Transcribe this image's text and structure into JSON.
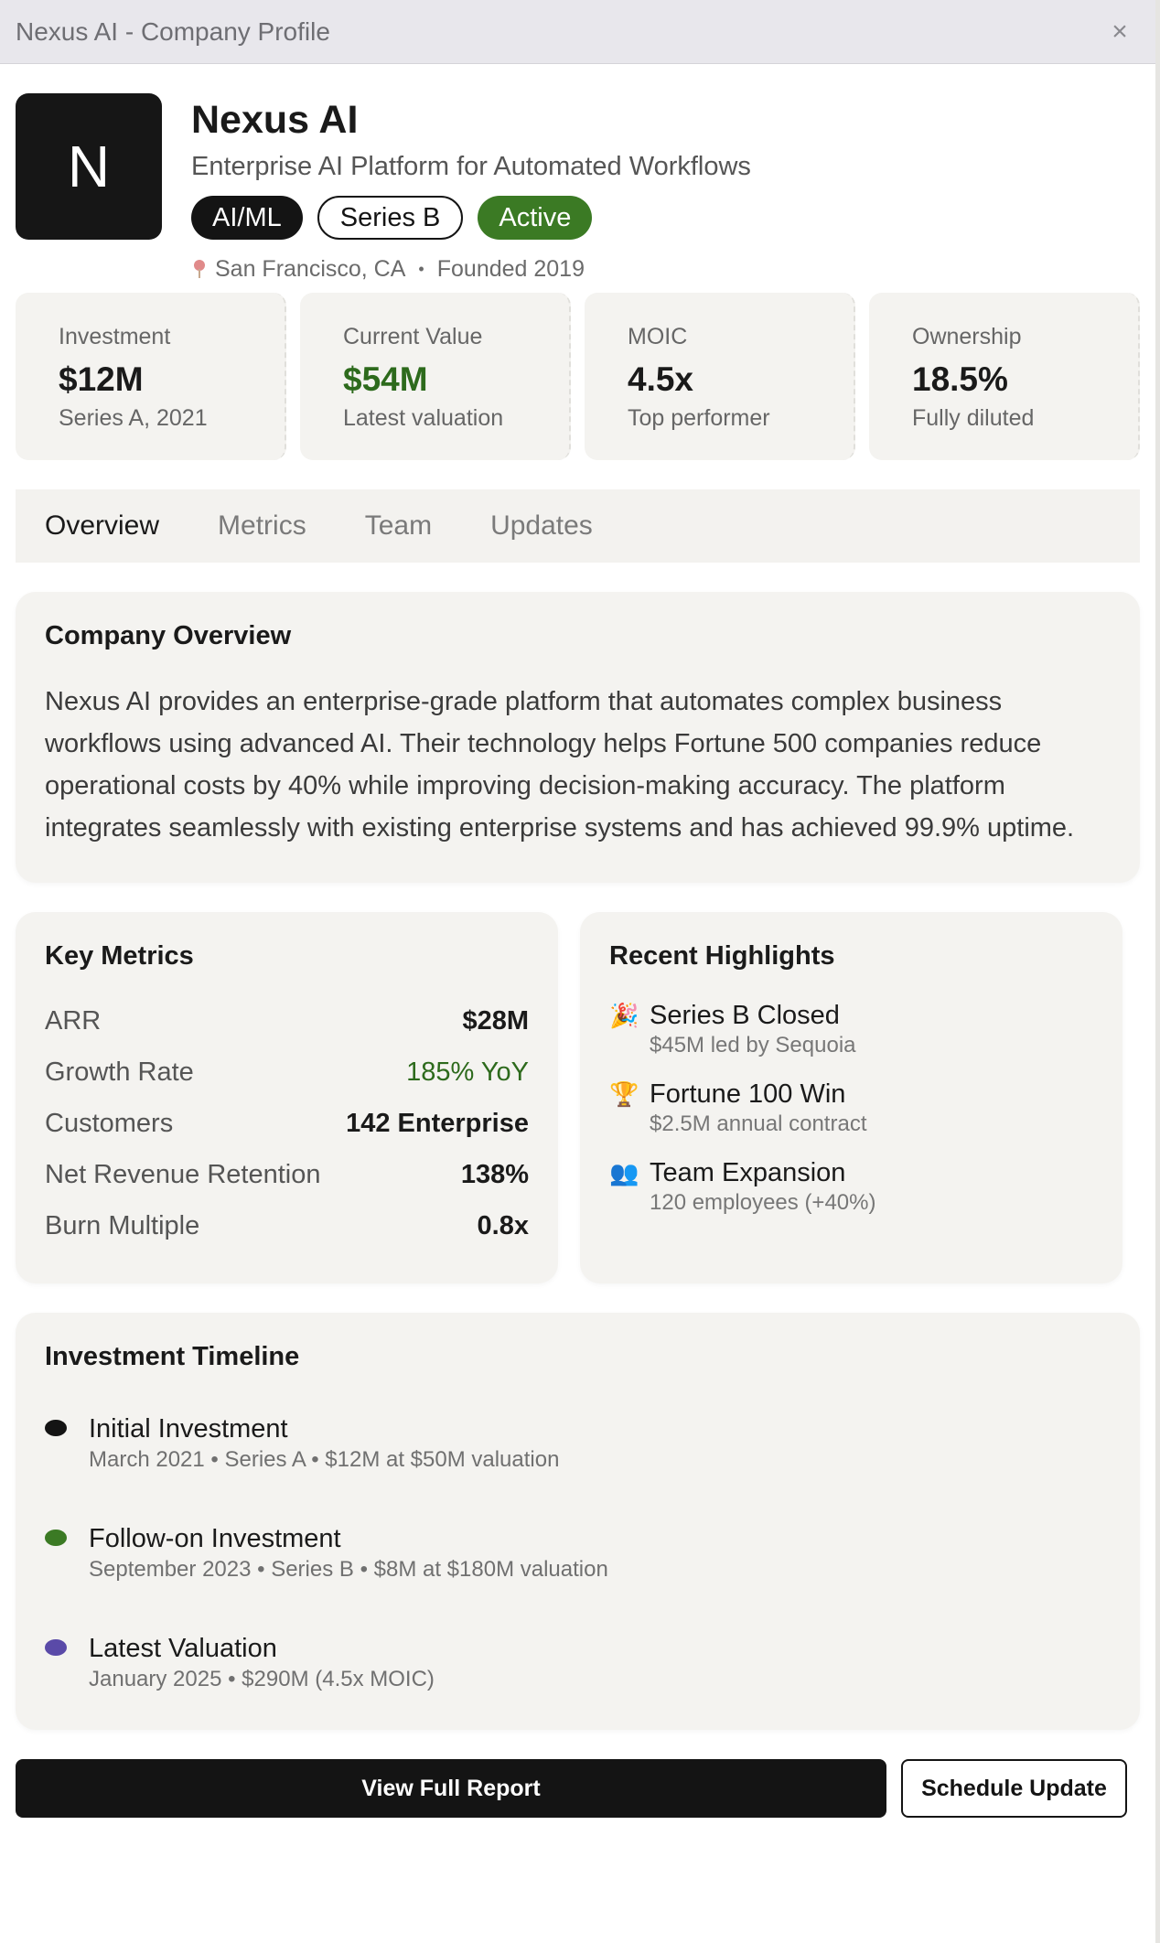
{
  "window": {
    "title": "Nexus AI - Company Profile",
    "close_symbol": "×"
  },
  "company": {
    "logo_letter": "N",
    "name": "Nexus AI",
    "tagline": "Enterprise AI Platform for Automated Workflows",
    "tags": [
      "AI/ML",
      "Series B",
      "Active"
    ],
    "location": "San Francisco, CA",
    "separator": "•",
    "founded": "Founded 2019"
  },
  "stats": [
    {
      "label": "Investment",
      "value": "$12M",
      "sub": "Series A, 2021"
    },
    {
      "label": "Current Value",
      "value": "$54M",
      "sub": "Latest valuation"
    },
    {
      "label": "MOIC",
      "value": "4.5x",
      "sub": "Top performer"
    },
    {
      "label": "Ownership",
      "value": "18.5%",
      "sub": "Fully diluted"
    }
  ],
  "tabs": [
    "Overview",
    "Metrics",
    "Team",
    "Updates"
  ],
  "overview": {
    "title": "Company Overview",
    "text": "Nexus AI provides an enterprise-grade platform that automates complex business workflows using advanced AI. Their technology helps Fortune 500 companies reduce operational costs by 40% while improving decision-making accuracy. The platform integrates seamlessly with existing enterprise systems and has achieved 99.9% uptime."
  },
  "key_metrics": {
    "title": "Key Metrics",
    "rows": [
      {
        "label": "ARR",
        "value": "$28M"
      },
      {
        "label": "Growth Rate",
        "value": "185% YoY"
      },
      {
        "label": "Customers",
        "value": "142 Enterprise"
      },
      {
        "label": "Net Revenue Retention",
        "value": "138%"
      },
      {
        "label": "Burn Multiple",
        "value": "0.8x"
      }
    ]
  },
  "highlights": {
    "title": "Recent Highlights",
    "items": [
      {
        "icon": "🎉",
        "title": "Series B Closed",
        "sub": "$45M led by Sequoia"
      },
      {
        "icon": "🏆",
        "title": "Fortune 100 Win",
        "sub": "$2.5M annual contract"
      },
      {
        "icon": "👥",
        "title": "Team Expansion",
        "sub": "120 employees (+40%)"
      }
    ]
  },
  "timeline": {
    "title": "Investment Timeline",
    "items": [
      {
        "title": "Initial Investment",
        "sub": "March 2021 • Series A • $12M at $50M valuation",
        "color": "#141414"
      },
      {
        "title": "Follow-on Investment",
        "sub": "September 2023 • Series B • $8M at $180M valuation",
        "color": "#3b7a24"
      },
      {
        "title": "Latest Valuation",
        "sub": "January 2025 • $290M (4.5x MOIC)",
        "color": "#5a4aa8"
      }
    ]
  },
  "actions": {
    "primary": "View Full Report",
    "secondary": "Schedule Update"
  },
  "colors": {
    "accent_green": "#3b7a24",
    "dark": "#141414",
    "purple": "#5a4aa8"
  }
}
